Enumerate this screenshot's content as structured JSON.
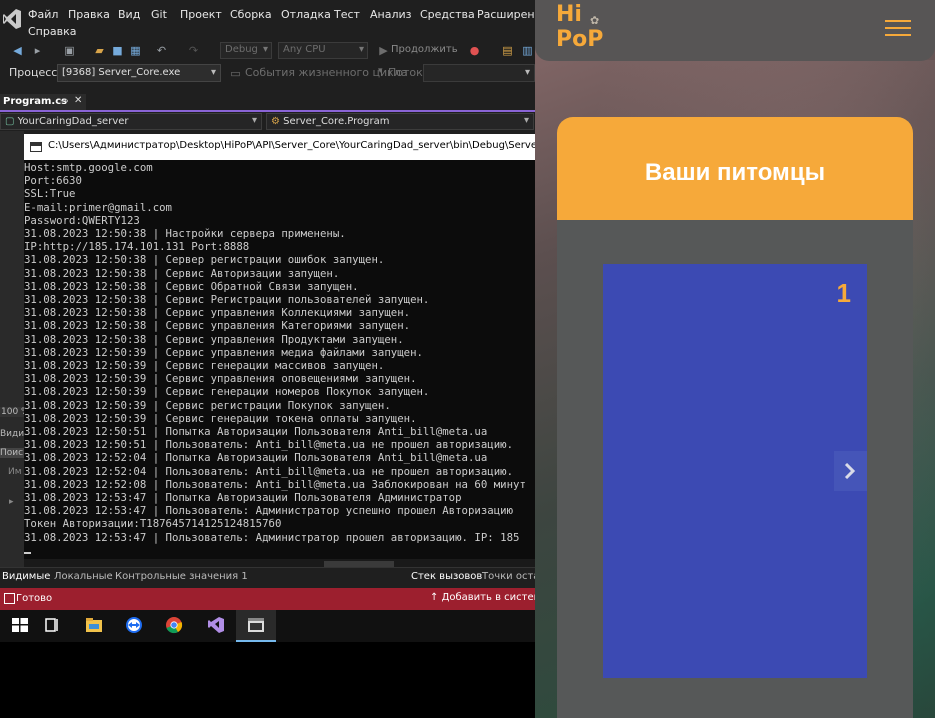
{
  "vs": {
    "menu": [
      "Файл",
      "Правка",
      "Вид",
      "Git",
      "Проект",
      "Сборка",
      "Отладка",
      "Тест",
      "Анализ",
      "Средства",
      "Расширения"
    ],
    "menu_help": "Справка",
    "toolbar": {
      "config": "Debug",
      "platform": "Any CPU",
      "continue": "Продолжить"
    },
    "procbar": {
      "process_label": "Процесс:",
      "process_value": "[9368] Server_Core.exe",
      "lifecycle": "События жизненного цикла",
      "thread_label": "Поток:"
    },
    "tab": "Program.cs",
    "nav": {
      "project": "YourCaringDad_server",
      "class": "Server_Core.Program"
    },
    "side": {
      "zoom": "100 %",
      "item1": "Види",
      "item2": "Поис",
      "item3": "Им"
    },
    "console": {
      "title": "C:\\Users\\Администратор\\Desktop\\HiPoP\\API\\Server_Core\\YourCaringDad_server\\bin\\Debug\\Server_Core.exe",
      "lines": [
        "Host:smtp.google.com",
        "Port:6630",
        "SSL:True",
        "E-mail:primer@gmail.com",
        "Password:QWERTY123",
        "31.08.2023 12:50:38 | Настройки сервера применены.",
        "IP:http://185.174.101.131 Port:8888",
        "31.08.2023 12:50:38 | Сервер регистрации ошибок запущен.",
        "31.08.2023 12:50:38 | Сервис Авторизации запущен.",
        "31.08.2023 12:50:38 | Сервис Обратной Связи запущен.",
        "31.08.2023 12:50:38 | Сервис Регистрации пользователей запущен.",
        "31.08.2023 12:50:38 | Сервис управления Коллекциями запущен.",
        "31.08.2023 12:50:38 | Сервис управления Категориями запущен.",
        "31.08.2023 12:50:38 | Сервис управления Продуктами запущен.",
        "31.08.2023 12:50:39 | Сервис управления медиа файлами запущен.",
        "31.08.2023 12:50:39 | Сервис генерации массивов запущен.",
        "31.08.2023 12:50:39 | Сервис управления оповещениями запущен.",
        "31.08.2023 12:50:39 | Сервис генерации номеров Покупок запущен.",
        "31.08.2023 12:50:39 | Сервис регистрации Покупок запущен.",
        "31.08.2023 12:50:39 | Сервис генерации токена оплаты запущен.",
        "31.08.2023 12:50:51 | Попытка Авторизации Пользователя Anti_bill@meta.ua",
        "31.08.2023 12:50:51 | Пользователь: Anti_bill@meta.ua не прошел авторизацию.",
        "31.08.2023 12:52:04 | Попытка Авторизации Пользователя Anti_bill@meta.ua",
        "31.08.2023 12:52:04 | Пользователь: Anti_bill@meta.ua не прошел авторизацию.",
        "31.08.2023 12:52:08 | Пользователь: Anti_bill@meta.ua Заблокирован на 60 минут",
        "31.08.2023 12:53:47 | Попытка Авторизации Пользователя Администратор",
        "31.08.2023 12:53:47 | Пользователь: Администратор успешно прошел Авторизацию",
        "Токен Авторизации:Т1876457141251248157б0",
        "31.08.2023 12:53:47 | Пользователь: Администратор прошел авторизацию. IP: 185"
      ]
    },
    "bottom_tabs": {
      "autos": "Видимые",
      "locals": "Локальные",
      "watch": "Контрольные значения 1",
      "callstack": "Стек вызовов",
      "breakpoints": "Точки оста"
    },
    "status": {
      "ready": "Готово",
      "add_to_source": "Добавить в систему"
    }
  },
  "app": {
    "logo_line1": "Hi",
    "logo_line2": "PoP",
    "section_title": "Ваши питомцы",
    "slide_number": "1",
    "accent": "#f6a93a",
    "slide_color": "#3c4ab3"
  }
}
